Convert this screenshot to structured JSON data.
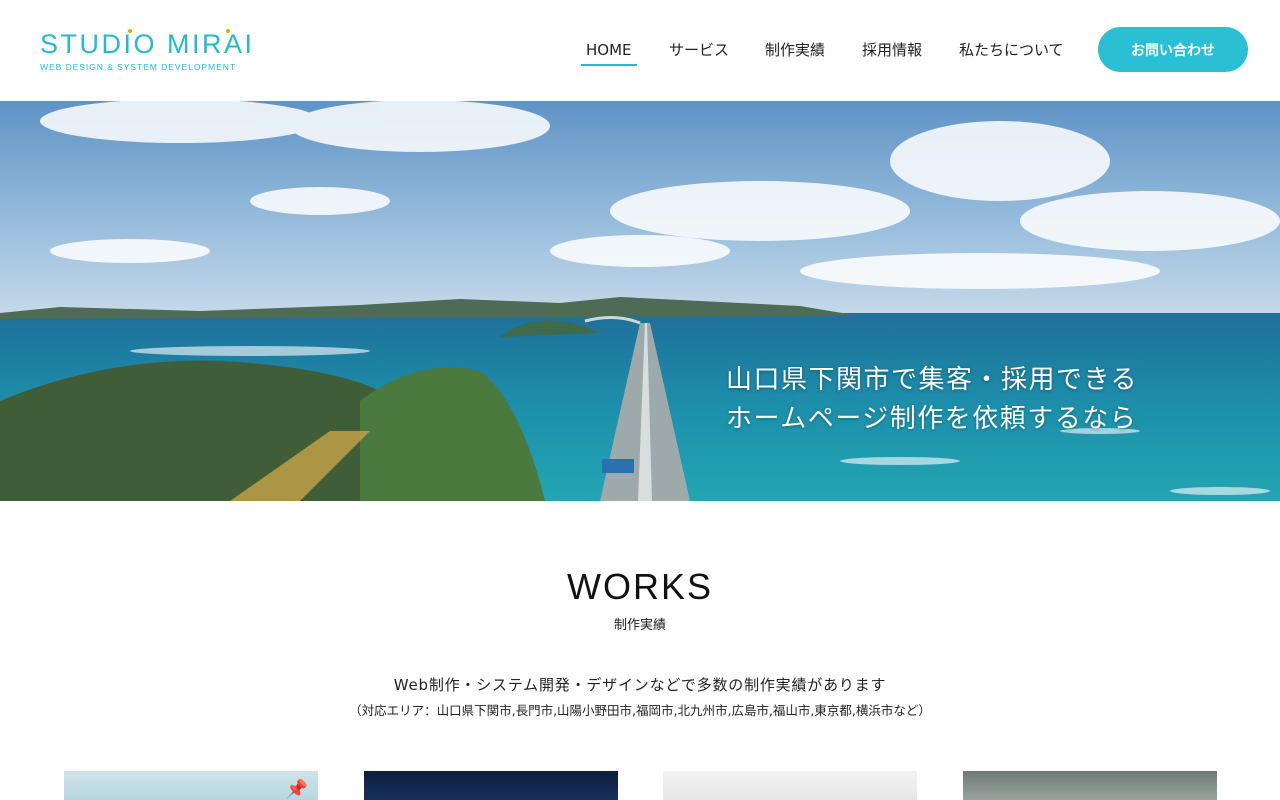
{
  "header": {
    "logo": {
      "title": "STUDIO MIRAI",
      "tagline": "WEB DESIGN & SYSTEM DEVELOPMENT"
    },
    "nav": [
      {
        "label": "HOME",
        "active": true
      },
      {
        "label": "サービス",
        "active": false
      },
      {
        "label": "制作実績",
        "active": false
      },
      {
        "label": "採用情報",
        "active": false
      },
      {
        "label": "私たちについて",
        "active": false
      }
    ],
    "cta_label": "お問い合わせ"
  },
  "hero": {
    "line1": "山口県下関市で集客・採用できる",
    "line2": "ホームページ制作を依頼するなら"
  },
  "works": {
    "title": "WORKS",
    "subtitle": "制作実績",
    "lead": "Web制作・システム開発・デザインなどで多数の制作実績があります",
    "area": "（対応エリア：山口県下関市,長門市,山陽小野田市,福岡市,北九州市,広島市,福山市,東京都,横浜市など）",
    "thumbnails": [
      {
        "icon": "pin-icon"
      },
      {
        "icon": ""
      },
      {
        "icon": ""
      },
      {
        "icon": ""
      }
    ]
  },
  "colors": {
    "accent": "#2ab6cc",
    "cta": "#2bbfd3",
    "logo_dot": "#f0a500"
  }
}
